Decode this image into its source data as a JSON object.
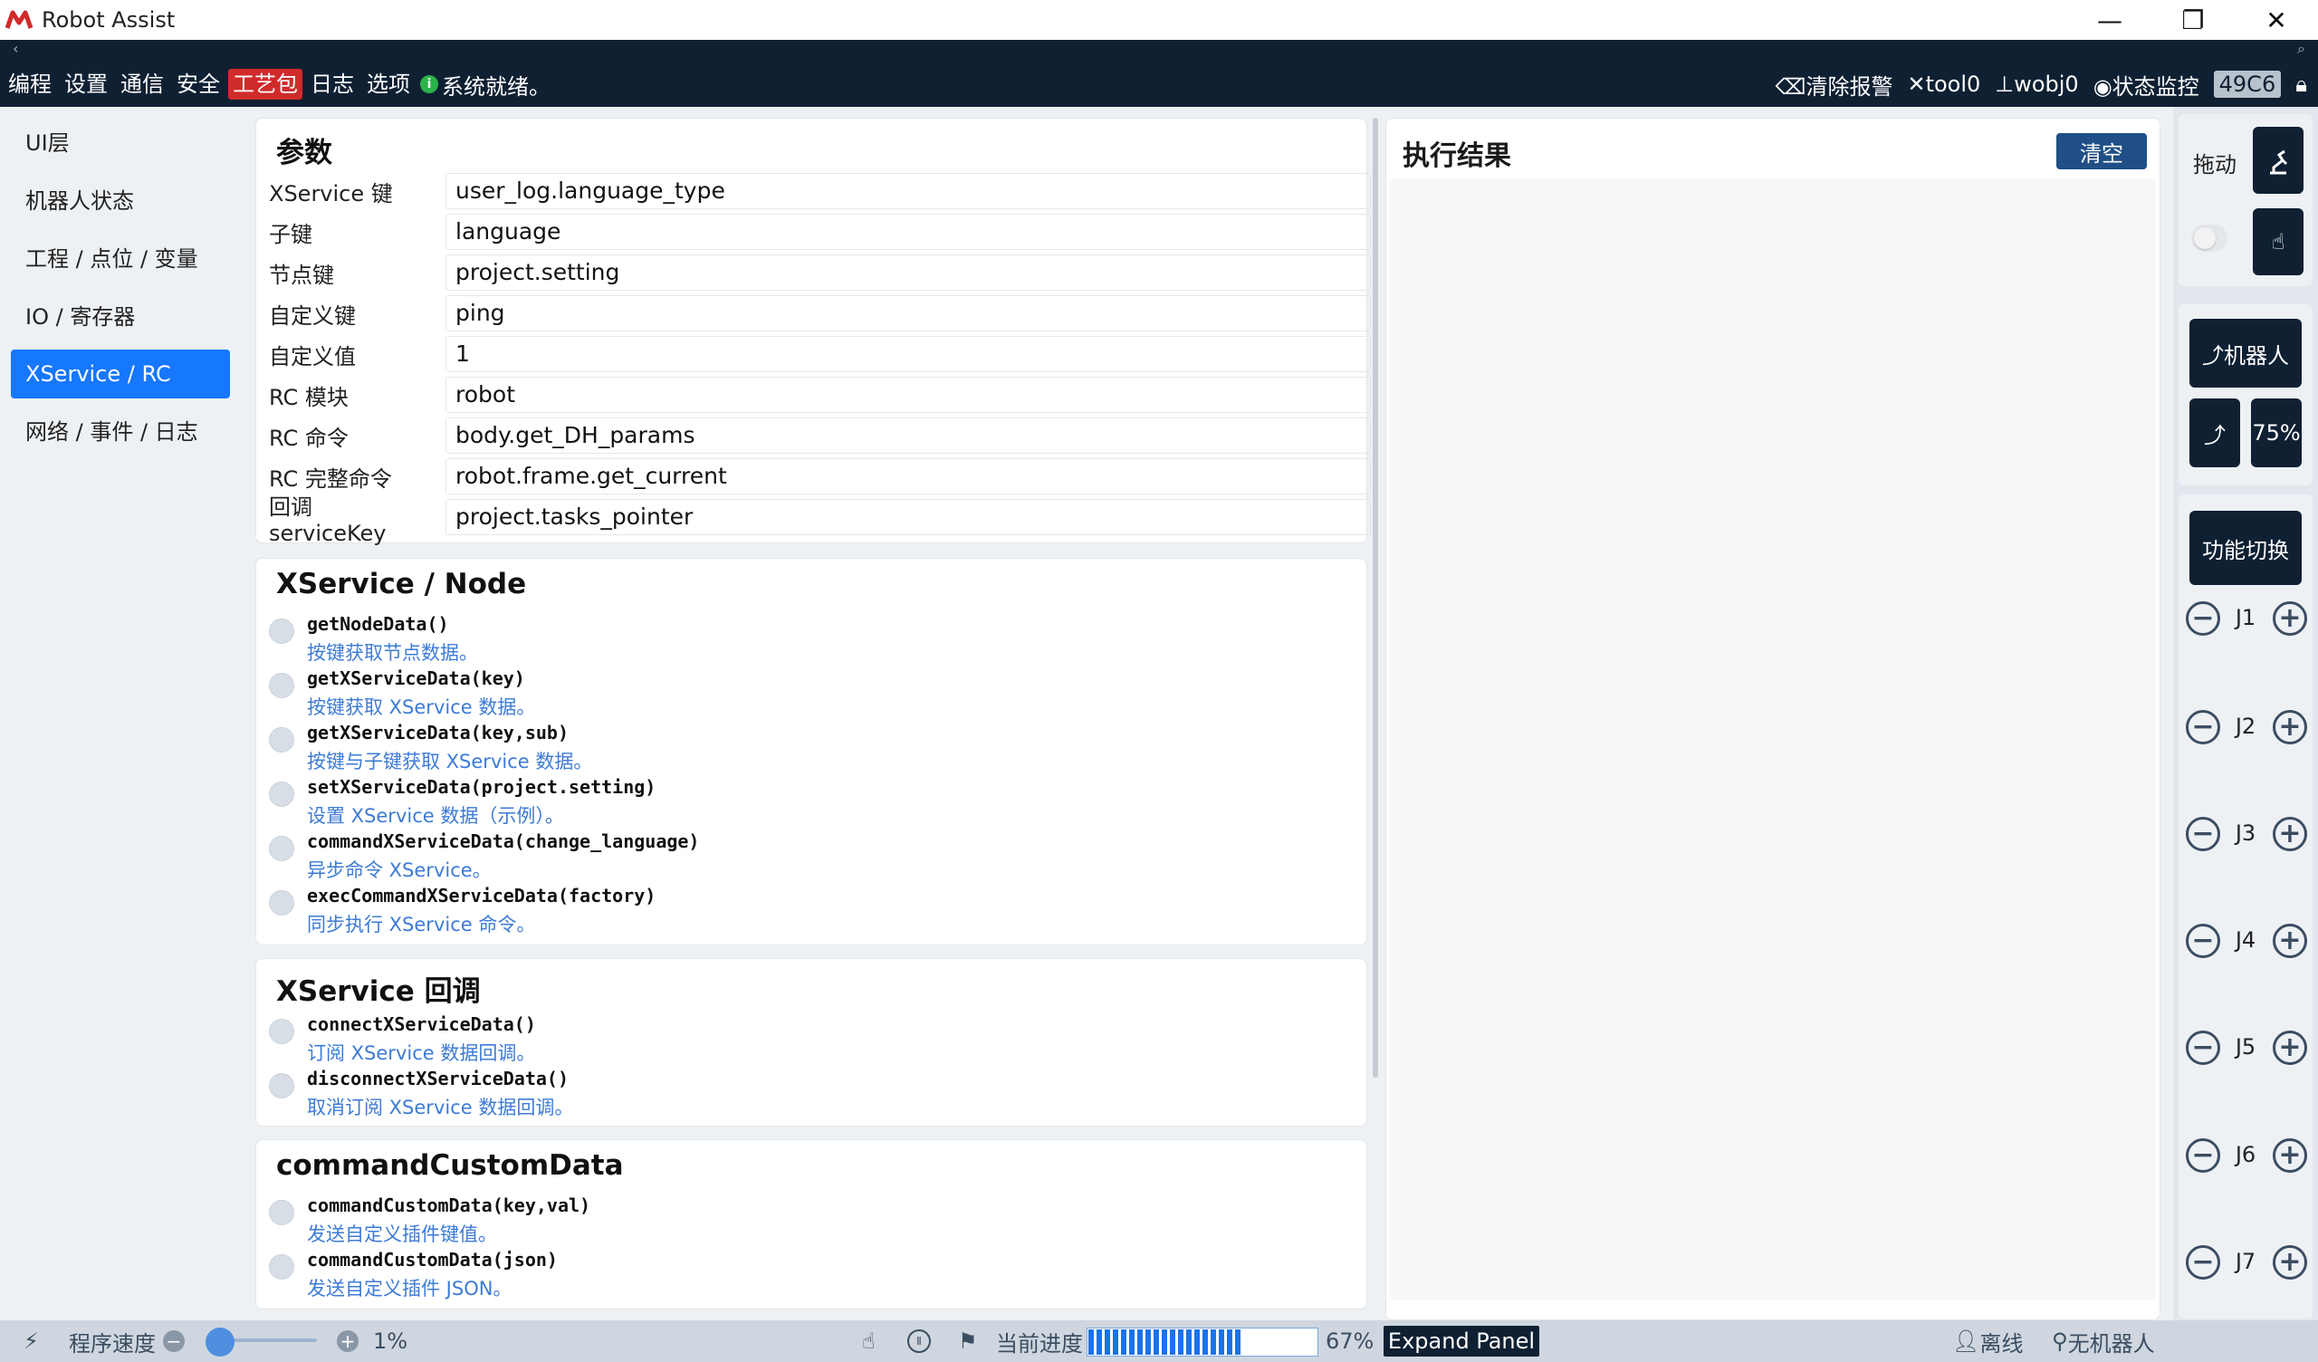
{
  "window": {
    "title": "Robot Assist",
    "minimize": "—",
    "restore": "❐",
    "close": "✕"
  },
  "substrip": {
    "left": "‹",
    "right": "⌕"
  },
  "menubar": {
    "items": [
      "编程",
      "设置",
      "通信",
      "安全",
      "工艺包",
      "日志",
      "选项"
    ],
    "status_icon": "i",
    "status_text": "系统就绪。",
    "clear_alarm": "清除报警",
    "tool": "tool0",
    "wobj": "wobj0",
    "monitor": "状态监控",
    "code": "49C6",
    "status_color": "#2cb34a",
    "active_color": "#d02b2b"
  },
  "leftnav": {
    "items": [
      {
        "label": "UI层"
      },
      {
        "label": "机器人状态"
      },
      {
        "label": "工程 / 点位 / 变量"
      },
      {
        "label": "IO / 寄存器"
      },
      {
        "label": "XService / RC"
      },
      {
        "label": "网络 / 事件 / 日志"
      }
    ],
    "active_index": 4
  },
  "params": {
    "title": "参数",
    "rows": [
      {
        "label": "XService 键",
        "value": "user_log.language_type"
      },
      {
        "label": "子键",
        "value": "language"
      },
      {
        "label": "节点键",
        "value": "project.setting"
      },
      {
        "label": "自定义键",
        "value": "ping"
      },
      {
        "label": "自定义值",
        "value": "1"
      },
      {
        "label": "RC 模块",
        "value": "robot"
      },
      {
        "label": "RC 命令",
        "value": "body.get_DH_params"
      },
      {
        "label": "RC 完整命令",
        "value": "robot.frame.get_current"
      },
      {
        "label": "回调 serviceKey",
        "value": "project.tasks_pointer"
      }
    ]
  },
  "xservice_node": {
    "title": "XService / Node",
    "items": [
      {
        "name": "getNodeData()",
        "desc": "按键获取节点数据。"
      },
      {
        "name": "getXServiceData(key)",
        "desc": "按键获取 XService 数据。"
      },
      {
        "name": "getXServiceData(key,sub)",
        "desc": "按键与子键获取 XService 数据。"
      },
      {
        "name": "setXServiceData(project.setting)",
        "desc": "设置 XService 数据（示例）。"
      },
      {
        "name": "commandXServiceData(change_language)",
        "desc": "异步命令 XService。"
      },
      {
        "name": "execCommandXServiceData(factory)",
        "desc": "同步执行 XService 命令。"
      }
    ]
  },
  "xservice_callback": {
    "title": "XService 回调",
    "items": [
      {
        "name": "connectXServiceData()",
        "desc": "订阅 XService 数据回调。"
      },
      {
        "name": "disconnectXServiceData()",
        "desc": "取消订阅 XService 数据回调。"
      }
    ]
  },
  "custom_data": {
    "title": "commandCustomData",
    "items": [
      {
        "name": "commandCustomData(key,val)",
        "desc": "发送自定义插件键值。"
      },
      {
        "name": "commandCustomData(json)",
        "desc": "发送自定义插件 JSON。"
      }
    ]
  },
  "result": {
    "title": "执行结果",
    "clear": "清空"
  },
  "right_panel": {
    "drag": "拖动",
    "robot": "机器人",
    "speed": "75%",
    "switch": "功能切换",
    "joints": [
      "J1",
      "J2",
      "J3",
      "J4",
      "J5",
      "J6",
      "J7"
    ],
    "minus": "−",
    "plus": "+"
  },
  "statusbar": {
    "program_speed": "程序速度",
    "speed_value": "1%",
    "speed_fraction": 0.01,
    "progress_label": "当前进度",
    "progress_percent": "67%",
    "progress_fraction": 0.67,
    "expand": "Expand Panel",
    "offline": "离线",
    "no_robot": "无机器人",
    "minus": "−",
    "plus": "+",
    "pause": "Ⅱ"
  }
}
